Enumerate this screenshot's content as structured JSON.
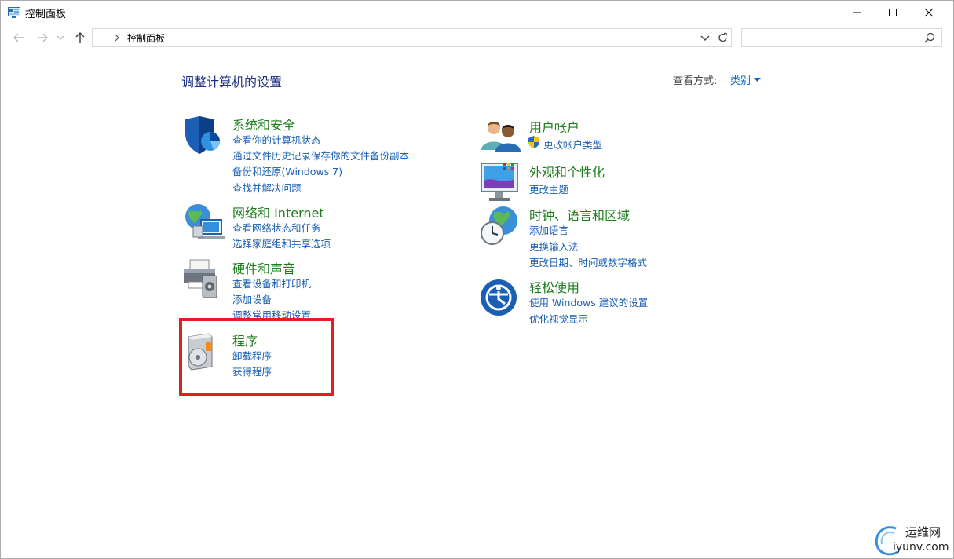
{
  "window": {
    "title": "控制面板"
  },
  "address": {
    "path": "控制面板",
    "search_placeholder": ""
  },
  "content": {
    "heading": "调整计算机的设置",
    "view_by_label": "查看方式:",
    "view_by_value": "类别"
  },
  "categories": {
    "system_security": {
      "title": "系统和安全",
      "links": [
        "查看你的计算机状态",
        "通过文件历史记录保存你的文件备份副本",
        "备份和还原(Windows 7)",
        "查找并解决问题"
      ]
    },
    "network": {
      "title": "网络和 Internet",
      "links": [
        "查看网络状态和任务",
        "选择家庭组和共享选项"
      ]
    },
    "hardware": {
      "title": "硬件和声音",
      "links": [
        "查看设备和打印机",
        "添加设备",
        "调整常用移动设置"
      ]
    },
    "programs": {
      "title": "程序",
      "links": [
        "卸载程序",
        "获得程序"
      ]
    },
    "user_accounts": {
      "title": "用户帐户",
      "links": [
        "更改帐户类型"
      ]
    },
    "appearance": {
      "title": "外观和个性化",
      "links": [
        "更改主题"
      ]
    },
    "clock_region": {
      "title": "时钟、语言和区域",
      "links": [
        "添加语言",
        "更换输入法",
        "更改日期、时间或数字格式"
      ]
    },
    "ease_access": {
      "title": "轻松使用",
      "links": [
        "使用 Windows 建议的设置",
        "优化视觉显示"
      ]
    }
  },
  "watermark": {
    "line1": "运维网",
    "line2": "iyunv.com"
  },
  "colors": {
    "category_title": "#1c7d1c",
    "link": "#1a5fb4",
    "heading": "#1e3287",
    "highlight": "#e02020"
  }
}
